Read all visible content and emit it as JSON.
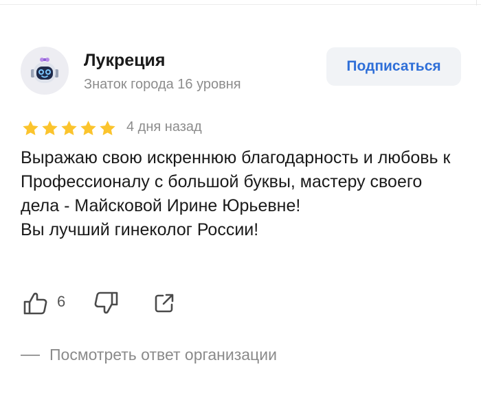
{
  "user": {
    "name": "Лукреция",
    "level": "Знаток города 16 уровня",
    "avatar_icon": "robot-avatar-icon"
  },
  "actions": {
    "subscribe_label": "Подписаться"
  },
  "review": {
    "rating": 5,
    "rating_max": 5,
    "date": "4 дня назад",
    "lines": [
      "Выражаю свою искреннюю благодарность и любовь к Профессионалу с большой буквы, мастеру своего дела - Майсковой Ирине Юрьевне!",
      "Вы лучший гинеколог России!"
    ],
    "likes": "6",
    "answer_link": "Посмотреть ответ организации"
  },
  "colors": {
    "accent": "#2f6fd8",
    "star": "#fbc42d",
    "muted": "#8c8c8c",
    "button_bg": "#f1f3f6"
  }
}
